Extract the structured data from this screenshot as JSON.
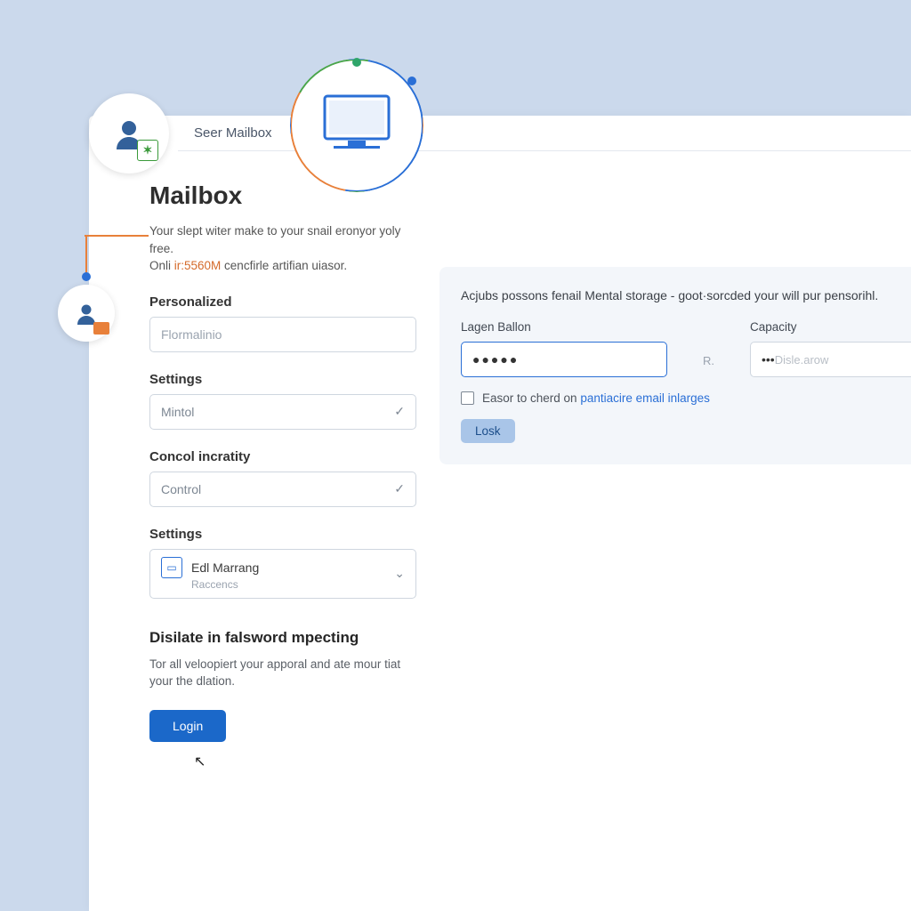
{
  "header": {
    "breadcrumb": "Seer Mailbox"
  },
  "hero": {
    "title": "Mailbox",
    "sub1": "Your slept witer make to your snail eronyor yoly free.",
    "sub2_prefix": "Onli ",
    "sub2_hl": "ir:5560M",
    "sub2_suffix": " cencfirle artifian uiasor."
  },
  "fields": {
    "personalized": {
      "label": "Personalized",
      "placeholder": "Flormalinio"
    },
    "settings1": {
      "label": "Settings",
      "value": "Mintol"
    },
    "concol": {
      "label": "Concol incratity",
      "value": "Control"
    },
    "settings2": {
      "label": "Settings",
      "title": "Edl Marrang",
      "sub": "Raccencs"
    }
  },
  "section": {
    "heading": "Disilate in falsword mpecting",
    "text": "Tor all veloopiert your apporal and ate mour tiat your the dlation.",
    "cta": "Login"
  },
  "panel": {
    "headline": "Acjubs possons fenail Mental storage - goot·sorcded your will pur pensorihl.",
    "col1": {
      "label": "Lagen Ballon",
      "value": "●●●●●"
    },
    "between": "R.",
    "col2": {
      "label": "Capacity",
      "placeholder_prefix": "••• ",
      "placeholder": "Disle.arow"
    },
    "checkbox_text": "Easor to cherd on ",
    "checkbox_link": "pantiacire email inlarges",
    "cta": "Losk"
  }
}
